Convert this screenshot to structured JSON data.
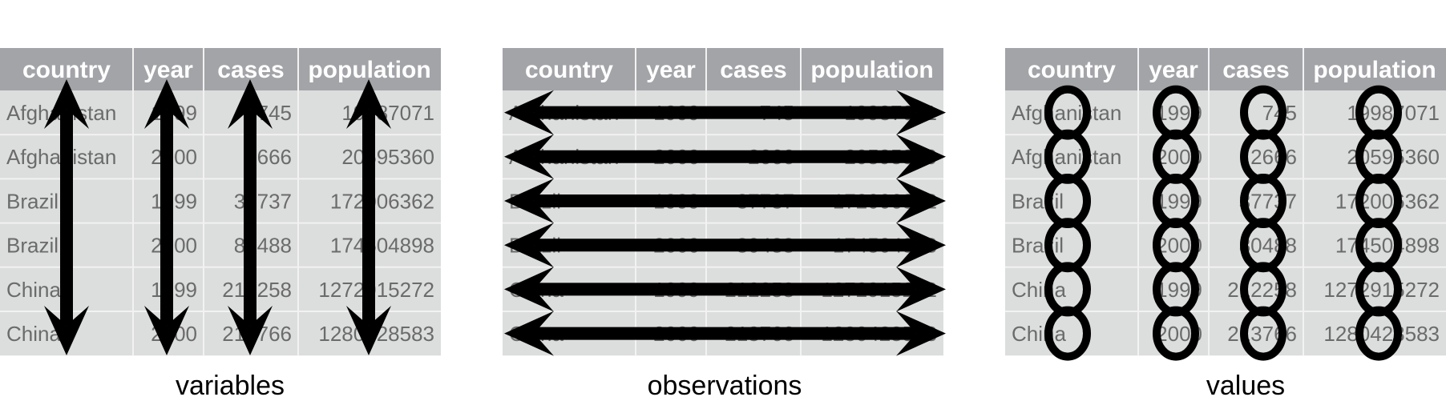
{
  "panels": [
    {
      "caption": "variables",
      "annotation": "vertical-double-arrows-per-column"
    },
    {
      "caption": "observations",
      "annotation": "horizontal-double-arrows-per-row"
    },
    {
      "caption": "values",
      "annotation": "circle-per-cell"
    }
  ],
  "table": {
    "columns": [
      "country",
      "year",
      "cases",
      "population"
    ],
    "rows": [
      [
        "Afghanistan",
        "1999",
        "745",
        "19987071"
      ],
      [
        "Afghanistan",
        "2000",
        "2666",
        "20595360"
      ],
      [
        "Brazil",
        "1999",
        "37737",
        "172006362"
      ],
      [
        "Brazil",
        "2000",
        "80488",
        "174504898"
      ],
      [
        "China",
        "1999",
        "212258",
        "1272915272"
      ],
      [
        "China",
        "2000",
        "213766",
        "1280428583"
      ]
    ]
  },
  "colors": {
    "header_bg": "#a3a4a8",
    "body_bg": "#dcdddd",
    "grid": "#f2f2f2",
    "cell_text": "#6b6b6b",
    "marks": "#000000"
  }
}
